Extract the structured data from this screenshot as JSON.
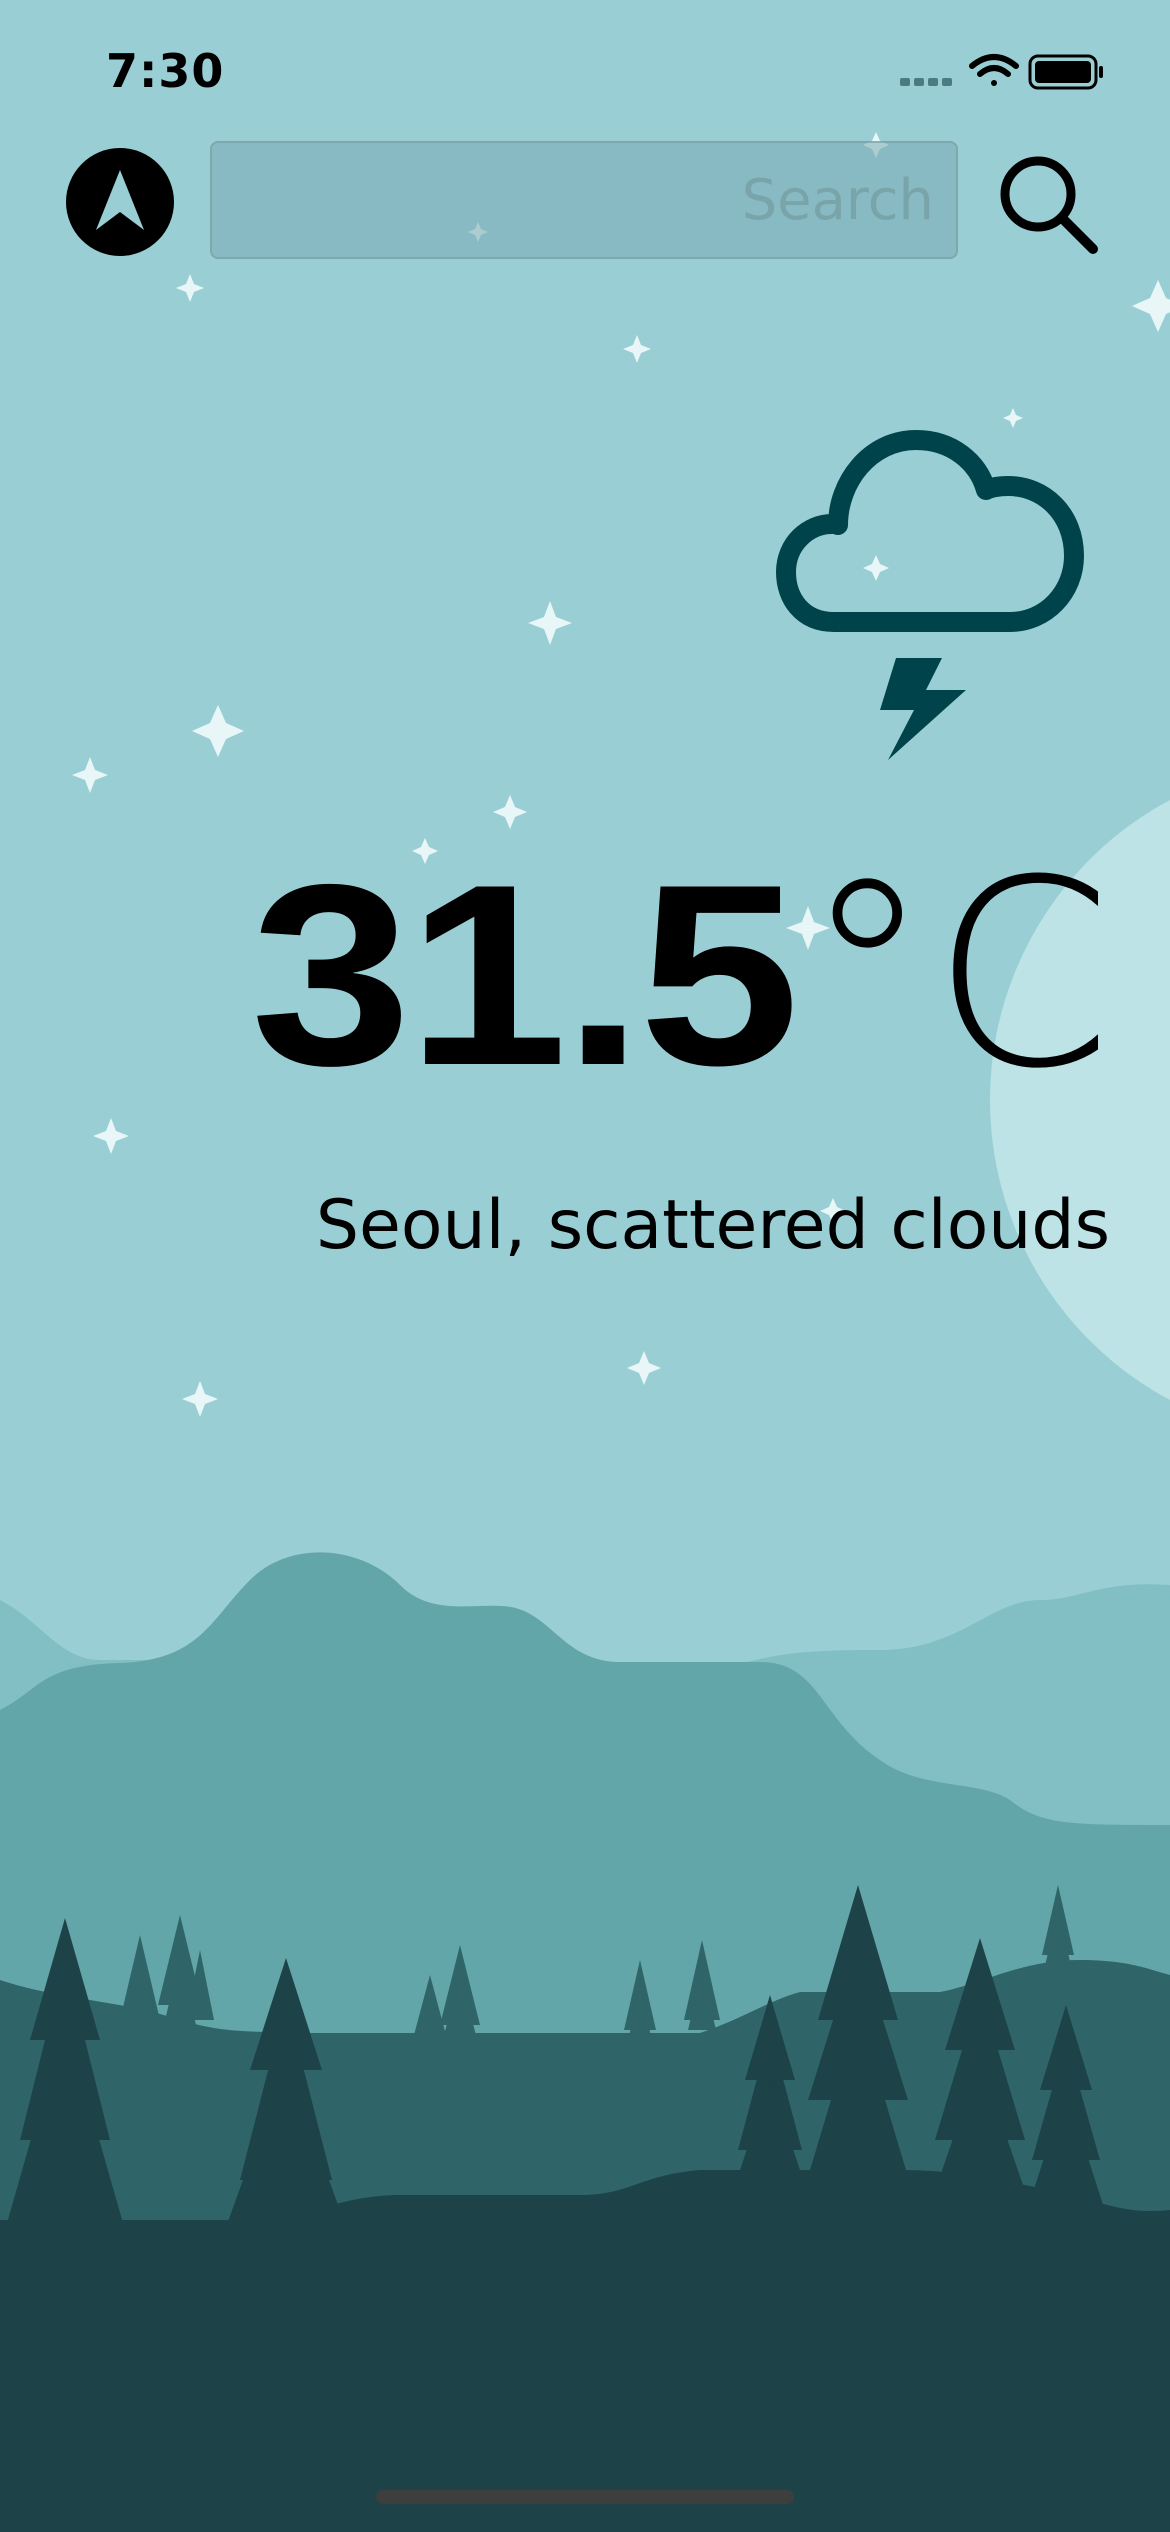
{
  "status_bar": {
    "time": "7:30",
    "icons": [
      "signal-icon",
      "wifi-icon",
      "battery-icon"
    ]
  },
  "header": {
    "location_button_icon": "navigation-arrow-icon",
    "search": {
      "placeholder": "Search",
      "value": ""
    },
    "search_button_icon": "search-icon"
  },
  "weather": {
    "icon": "thunderstorm-cloud-icon",
    "temperature": "31.5",
    "unit": "°C",
    "description": "Seoul, scattered clouds"
  },
  "colors": {
    "sky": "#99cfd4",
    "moon": "#bde3e7",
    "accent_dark": "#00434a",
    "hills_far": "#82bfc4",
    "hills_mid": "#63a6aa",
    "hills_near": "#2f6568",
    "ground": "#1d4349"
  }
}
